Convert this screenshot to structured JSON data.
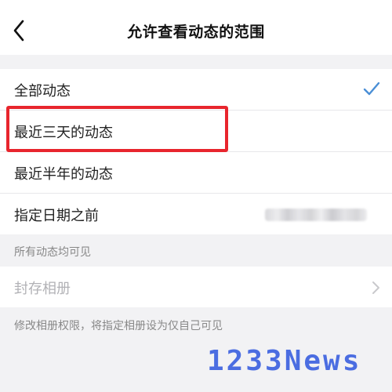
{
  "header": {
    "title": "允许查看动态的范围",
    "back_icon": "chevron-left-icon"
  },
  "range_options": [
    {
      "label": "全部动态",
      "selected": true
    },
    {
      "label": "最近三天的动态",
      "selected": false,
      "highlighted": true
    },
    {
      "label": "最近半年的动态",
      "selected": false
    },
    {
      "label": "指定日期之前",
      "selected": false,
      "value_redacted": true
    }
  ],
  "range_note": "所有动态均可见",
  "album": {
    "label": "封存相册",
    "enabled": false,
    "note": "修改相册权限，将指定相册设为仅自己可见"
  },
  "watermark": "1233News",
  "colors": {
    "check": "#4a8fd6",
    "highlight_box": "#e8252d",
    "watermark": "#3a5fe0"
  }
}
